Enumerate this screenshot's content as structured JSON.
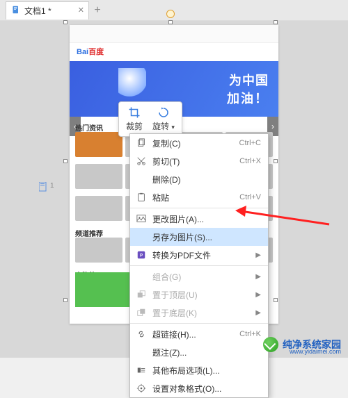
{
  "tab": {
    "title": "文档1 *",
    "add_label": "+"
  },
  "page_indicator": "1",
  "float_toolbar": {
    "crop": "裁剪",
    "rotate": "旋转"
  },
  "context_menu": {
    "copy": {
      "label": "复制(C)",
      "shortcut": "Ctrl+C"
    },
    "cut": {
      "label": "剪切(T)",
      "shortcut": "Ctrl+X"
    },
    "delete": {
      "label": "删除(D)",
      "shortcut": ""
    },
    "paste": {
      "label": "粘贴",
      "shortcut": "Ctrl+V"
    },
    "change": {
      "label": "更改图片(A)..."
    },
    "saveas": {
      "label": "另存为图片(S)..."
    },
    "pdf": {
      "label": "转换为PDF文件"
    },
    "group": {
      "label": "组合(G)"
    },
    "front": {
      "label": "置于顶层(U)"
    },
    "back": {
      "label": "置于底层(K)"
    },
    "link": {
      "label": "超链接(H)...",
      "shortcut": "Ctrl+K"
    },
    "caption": {
      "label": "题注(Z)..."
    },
    "layout": {
      "label": "其他布局选项(L)..."
    },
    "format": {
      "label": "设置对象格式(O)..."
    }
  },
  "page_content": {
    "logo_a": "Bai",
    "logo_b": "百度",
    "hero1": "为中国",
    "hero2": "加油！",
    "section1": "热门资讯",
    "section2": "频道推荐",
    "section3": "人物热"
  },
  "watermark": {
    "name": "纯净系统家园",
    "url": "www.yidaimei.com"
  }
}
